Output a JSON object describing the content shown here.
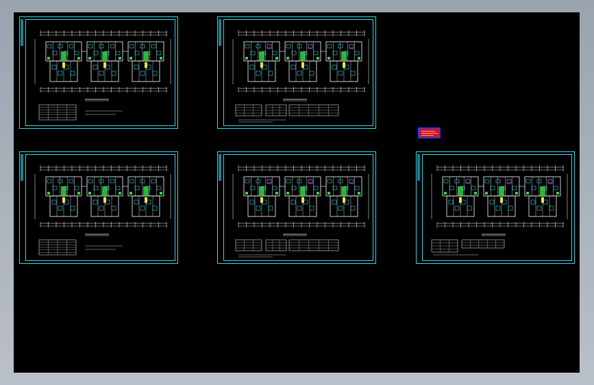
{
  "app": {
    "background_color": "#000000",
    "frame_color": "#3fd6e6"
  },
  "sheets": [
    {
      "id": "sheet-1",
      "variant": "a"
    },
    {
      "id": "sheet-2",
      "variant": "b"
    },
    {
      "id": "sheet-3",
      "variant": "a"
    },
    {
      "id": "sheet-4",
      "variant": "b"
    },
    {
      "id": "sheet-5",
      "variant": "c"
    }
  ],
  "stamp": {
    "fill_color": "#d81414",
    "border_color": "#1f3dff"
  }
}
